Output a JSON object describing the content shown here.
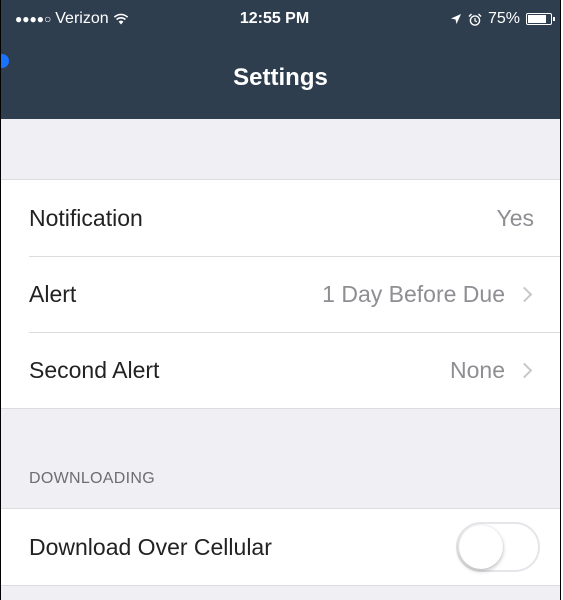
{
  "status_bar": {
    "signal": "●●●●○",
    "carrier": "Verizon",
    "wifi_icon": "wifi-icon",
    "time": "12:55 PM",
    "location_icon": "location-arrow-icon",
    "alarm_icon": "alarm-icon",
    "battery_percent": "75%",
    "battery_level": 0.75
  },
  "nav": {
    "title": "Settings"
  },
  "settings": {
    "rows": [
      {
        "label": "Notification",
        "value": "Yes"
      },
      {
        "label": "Alert",
        "value": "1 Day Before Due"
      },
      {
        "label": "Second Alert",
        "value": "None"
      }
    ]
  },
  "downloading": {
    "header": "DOWNLOADING",
    "cellular_label": "Download Over Cellular",
    "cellular_enabled": false
  },
  "colors": {
    "header_bg": "#2f3e4e",
    "page_bg": "#efeff4",
    "accent_blue": "#1a73ff"
  }
}
